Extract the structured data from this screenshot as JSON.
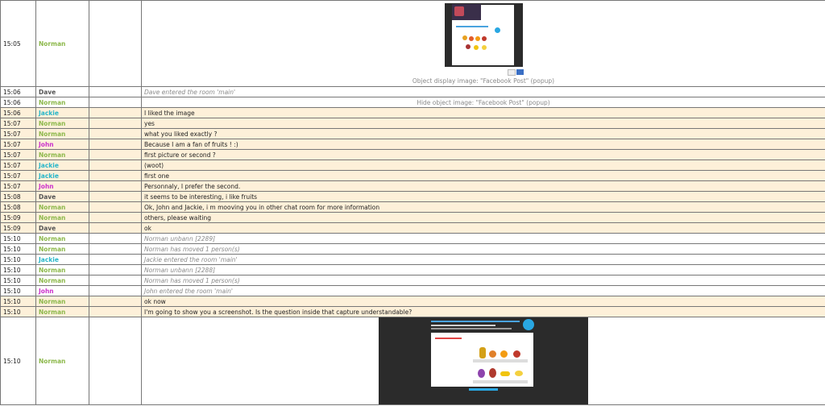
{
  "rows": [
    {
      "time": "15:05",
      "name": "Norman",
      "color": "#8cb84a",
      "caption": "Object display image: \"Facebook Post\" (popup)"
    },
    {
      "time": "15:06",
      "name": "Dave",
      "color": "#555555",
      "msg": "Dave entered the room 'main'"
    },
    {
      "time": "15:06",
      "name": "Norman",
      "color": "#8cb84a",
      "msg": "Hide object image: \"Facebook Post\" (popup)"
    },
    {
      "time": "15:06",
      "name": "Jackie",
      "color": "#27b6c9",
      "msg": "I liked the image"
    },
    {
      "time": "15:07",
      "name": "Norman",
      "color": "#8cb84a",
      "msg": "yes"
    },
    {
      "time": "15:07",
      "name": "Norman",
      "color": "#8cb84a",
      "msg": "what you liked exactly ?"
    },
    {
      "time": "15:07",
      "name": "John",
      "color": "#cc33cc",
      "msg": "Because I am a fan of fruits ! :)"
    },
    {
      "time": "15:07",
      "name": "Norman",
      "color": "#8cb84a",
      "msg": "first picture or second ?"
    },
    {
      "time": "15:07",
      "name": "Jackie",
      "color": "#27b6c9",
      "msg": "(woot)"
    },
    {
      "time": "15:07",
      "name": "Jackie",
      "color": "#27b6c9",
      "msg": "first one"
    },
    {
      "time": "15:07",
      "name": "John",
      "color": "#cc33cc",
      "msg": "Personnaly, I prefer the second."
    },
    {
      "time": "15:08",
      "name": "Dave",
      "color": "#555555",
      "msg": "it seems to be interesting, i like fruits"
    },
    {
      "time": "15:08",
      "name": "Norman",
      "color": "#8cb84a",
      "msg": "Ok, John and Jackie, i m mooving you in other chat room for more information"
    },
    {
      "time": "15:09",
      "name": "Norman",
      "color": "#8cb84a",
      "msg": "others, please waiting"
    },
    {
      "time": "15:09",
      "name": "Dave",
      "color": "#555555",
      "msg": "ok"
    },
    {
      "time": "15:10",
      "name": "Norman",
      "color": "#8cb84a",
      "msg": "Norman unbann [2289]"
    },
    {
      "time": "15:10",
      "name": "Norman",
      "color": "#8cb84a",
      "msg": "Norman has moved 1 person(s)"
    },
    {
      "time": "15:10",
      "name": "Jackie",
      "color": "#27b6c9",
      "msg": "Jackie entered the room 'main'"
    },
    {
      "time": "15:10",
      "name": "Norman",
      "color": "#8cb84a",
      "msg": "Norman unbann [2288]"
    },
    {
      "time": "15:10",
      "name": "Norman",
      "color": "#8cb84a",
      "msg": "Norman has moved 1 person(s)"
    },
    {
      "time": "15:10",
      "name": "John",
      "color": "#cc33cc",
      "msg": "John entered the room 'main'"
    },
    {
      "time": "15:10",
      "name": "Norman",
      "color": "#8cb84a",
      "msg": "ok now"
    },
    {
      "time": "15:10",
      "name": "Norman",
      "color": "#8cb84a",
      "msg": "I'm going to show you a screenshot. Is the question inside that capture understandable?"
    },
    {
      "time": "15:10",
      "name": "Norman",
      "color": "#8cb84a"
    }
  ],
  "colors": {
    "row_highlight": "#fdf0d9",
    "border": "#777777"
  }
}
